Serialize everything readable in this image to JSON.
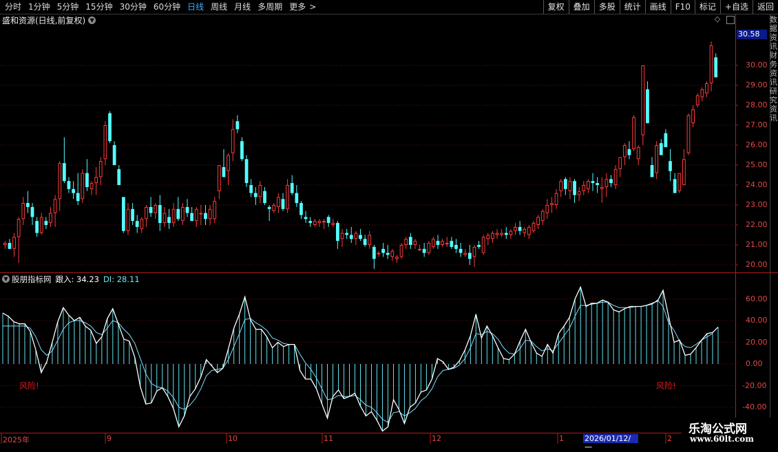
{
  "toolbar": {
    "tabs": [
      {
        "label": "分时",
        "active": false
      },
      {
        "label": "1分钟",
        "active": false
      },
      {
        "label": "5分钟",
        "active": false
      },
      {
        "label": "15分钟",
        "active": false
      },
      {
        "label": "30分钟",
        "active": false
      },
      {
        "label": "60分钟",
        "active": false
      },
      {
        "label": "日线",
        "active": true
      },
      {
        "label": "周线",
        "active": false
      },
      {
        "label": "月线",
        "active": false
      },
      {
        "label": "多周期",
        "active": false
      },
      {
        "label": "更多",
        "active": false
      }
    ],
    "right_buttons": [
      "复权",
      "叠加",
      "多股",
      "统计",
      "画线",
      "F10",
      "标记",
      "+自选",
      "返回"
    ]
  },
  "chart_title": "盛和资源(日线,前复权)",
  "indicator": {
    "name": "股朋指标网",
    "v1_label": "跟入: 34.23",
    "v2_label": "DI: 28.11"
  },
  "current_price": "30.58",
  "price_axis": [
    "30.00",
    "29.00",
    "28.00",
    "27.00",
    "26.00",
    "25.00",
    "24.00",
    "23.00",
    "22.00",
    "21.00",
    "20.00"
  ],
  "indicator_axis": [
    "60.00",
    "40.00",
    "20.00",
    "0.00",
    "-20.00",
    "-40.00"
  ],
  "dates": {
    "labels": [
      "2025年",
      "9",
      "10",
      "11",
      "12",
      "1",
      "2"
    ],
    "cursor": "2026/01/12/一"
  },
  "warnings": [
    "风险!",
    "风险!"
  ],
  "brand": {
    "name": "乐淘公式网",
    "url": "www.60lt.com"
  },
  "side_strip_text": "数据资讯财务资讯研究资讯",
  "colors": {
    "up": "#ff3c3c",
    "down": "#54ffff",
    "grid": "#7a1010",
    "axis": "#c01818",
    "line": "#ffffff",
    "di": "#7fdfff"
  },
  "chart_data": [
    {
      "type": "candlestick",
      "title": "盛和资源(日线,前复权)",
      "ylim": [
        19.6,
        31.2
      ],
      "candles": [
        [
          21.0,
          21.2,
          20.8,
          21.1
        ],
        [
          21.1,
          21.3,
          20.8,
          20.8
        ],
        [
          20.8,
          21.6,
          20.4,
          21.4
        ],
        [
          21.4,
          22.4,
          20.1,
          22.3
        ],
        [
          22.3,
          23.4,
          22.0,
          23.1
        ],
        [
          23.1,
          23.7,
          22.6,
          22.9
        ],
        [
          22.9,
          23.1,
          22.0,
          22.4
        ],
        [
          22.2,
          22.4,
          21.4,
          21.6
        ],
        [
          21.6,
          22.6,
          21.5,
          22.4
        ],
        [
          22.2,
          22.4,
          21.8,
          22.0
        ],
        [
          22.1,
          22.9,
          21.9,
          22.6
        ],
        [
          22.6,
          23.5,
          21.9,
          23.3
        ],
        [
          23.3,
          25.2,
          22.7,
          25.1
        ],
        [
          25.1,
          26.4,
          24.1,
          24.2
        ],
        [
          24.2,
          24.4,
          23.6,
          23.8
        ],
        [
          23.8,
          24.2,
          23.3,
          23.6
        ],
        [
          23.6,
          24.6,
          23.0,
          23.2
        ],
        [
          23.3,
          24.8,
          23.1,
          24.6
        ],
        [
          24.6,
          25.3,
          23.7,
          23.9
        ],
        [
          23.8,
          24.2,
          23.5,
          24.1
        ],
        [
          24.1,
          24.9,
          23.5,
          24.4
        ],
        [
          24.4,
          25.4,
          24.0,
          25.2
        ],
        [
          25.3,
          27.2,
          25.0,
          27.0
        ],
        [
          27.6,
          27.7,
          26.1,
          26.2
        ],
        [
          26.0,
          26.2,
          25.0,
          25.0
        ],
        [
          24.8,
          25.0,
          24.0,
          24.0
        ],
        [
          23.4,
          23.4,
          21.6,
          21.7
        ],
        [
          21.7,
          23.1,
          21.5,
          22.8
        ],
        [
          22.8,
          23.1,
          22.0,
          22.2
        ],
        [
          22.2,
          22.5,
          21.6,
          21.9
        ],
        [
          21.8,
          22.4,
          21.6,
          22.3
        ],
        [
          22.3,
          23.0,
          21.9,
          22.9
        ],
        [
          22.9,
          23.4,
          22.4,
          22.6
        ],
        [
          22.6,
          23.1,
          22.3,
          23.0
        ],
        [
          23.0,
          23.5,
          21.7,
          22.1
        ],
        [
          22.1,
          22.9,
          21.9,
          22.6
        ],
        [
          22.4,
          22.8,
          21.8,
          22.1
        ],
        [
          22.1,
          23.1,
          21.9,
          22.8
        ],
        [
          22.8,
          23.4,
          22.2,
          22.3
        ],
        [
          22.2,
          23.1,
          22.0,
          22.9
        ],
        [
          22.9,
          23.3,
          22.4,
          22.6
        ],
        [
          22.6,
          22.9,
          22.2,
          22.2
        ],
        [
          22.2,
          22.9,
          21.9,
          22.8
        ],
        [
          22.6,
          23.0,
          22.0,
          22.6
        ],
        [
          22.6,
          23.0,
          22.0,
          22.3
        ],
        [
          22.3,
          23.0,
          22.0,
          22.8
        ],
        [
          22.3,
          23.4,
          22.1,
          23.2
        ],
        [
          23.7,
          25.0,
          23.3,
          25.0
        ],
        [
          24.9,
          25.8,
          24.4,
          24.4
        ],
        [
          24.7,
          25.6,
          24.0,
          25.5
        ],
        [
          25.6,
          27.3,
          25.2,
          26.8
        ],
        [
          27.2,
          27.5,
          26.6,
          26.8
        ],
        [
          26.2,
          26.4,
          25.2,
          25.3
        ],
        [
          25.3,
          25.5,
          23.9,
          24.1
        ],
        [
          24.0,
          24.3,
          23.4,
          23.6
        ],
        [
          23.6,
          23.9,
          23.0,
          23.4
        ],
        [
          23.4,
          24.2,
          23.1,
          24.0
        ],
        [
          23.7,
          23.9,
          23.0,
          23.1
        ],
        [
          22.9,
          23.0,
          22.2,
          22.8
        ],
        [
          22.7,
          23.1,
          22.6,
          23.0
        ],
        [
          22.9,
          23.6,
          22.6,
          23.4
        ],
        [
          23.3,
          23.6,
          22.7,
          22.8
        ],
        [
          22.8,
          24.3,
          22.6,
          24.0
        ],
        [
          24.1,
          24.5,
          23.5,
          23.6
        ],
        [
          23.6,
          24.0,
          22.9,
          23.1
        ],
        [
          23.1,
          23.2,
          22.3,
          22.5
        ],
        [
          22.4,
          22.7,
          22.1,
          22.3
        ],
        [
          22.2,
          22.4,
          21.9,
          22.1
        ],
        [
          22.0,
          22.3,
          21.9,
          22.2
        ],
        [
          22.1,
          22.3,
          21.9,
          22.2
        ],
        [
          22.2,
          22.3,
          21.8,
          22.2
        ],
        [
          22.4,
          22.5,
          21.9,
          22.1
        ],
        [
          22.0,
          22.3,
          21.9,
          22.1
        ],
        [
          22.1,
          22.2,
          20.8,
          21.2
        ],
        [
          21.3,
          21.8,
          20.9,
          21.6
        ],
        [
          21.6,
          21.8,
          21.3,
          21.5
        ],
        [
          21.5,
          21.9,
          21.1,
          21.3
        ],
        [
          21.3,
          21.7,
          21.0,
          21.6
        ],
        [
          21.5,
          21.8,
          21.2,
          21.3
        ],
        [
          21.3,
          21.5,
          20.9,
          21.0
        ],
        [
          21.0,
          21.7,
          20.8,
          21.5
        ],
        [
          20.9,
          21.0,
          19.8,
          20.3
        ],
        [
          20.6,
          20.7,
          20.4,
          20.6
        ],
        [
          20.8,
          21.1,
          20.4,
          20.6
        ],
        [
          20.6,
          21.0,
          20.3,
          20.5
        ],
        [
          20.4,
          20.8,
          20.2,
          20.7
        ],
        [
          20.3,
          20.5,
          20.1,
          20.4
        ],
        [
          20.4,
          21.1,
          20.3,
          21.0
        ],
        [
          21.0,
          21.4,
          20.8,
          21.3
        ],
        [
          21.4,
          21.6,
          20.8,
          21.0
        ],
        [
          21.0,
          21.3,
          20.8,
          21.2
        ],
        [
          20.8,
          21.0,
          20.7,
          20.8
        ],
        [
          20.8,
          21.1,
          20.4,
          20.6
        ],
        [
          20.6,
          21.2,
          20.5,
          21.1
        ],
        [
          20.9,
          21.4,
          20.8,
          21.3
        ],
        [
          21.2,
          21.5,
          20.8,
          21.0
        ],
        [
          21.0,
          21.3,
          20.9,
          21.2
        ],
        [
          21.1,
          21.4,
          20.9,
          21.1
        ],
        [
          21.2,
          21.4,
          20.8,
          20.9
        ],
        [
          21.0,
          21.3,
          20.6,
          20.8
        ],
        [
          20.8,
          21.1,
          20.4,
          20.6
        ],
        [
          20.5,
          20.8,
          20.4,
          20.6
        ],
        [
          20.6,
          21.0,
          20.0,
          20.3
        ],
        [
          20.4,
          21.0,
          19.9,
          20.9
        ],
        [
          21.0,
          21.2,
          20.8,
          20.9
        ],
        [
          20.6,
          21.5,
          20.5,
          21.4
        ],
        [
          21.3,
          21.6,
          21.0,
          21.5
        ],
        [
          21.3,
          21.7,
          21.1,
          21.6
        ],
        [
          21.5,
          21.8,
          21.3,
          21.6
        ],
        [
          21.5,
          21.8,
          21.4,
          21.6
        ],
        [
          21.6,
          21.9,
          21.3,
          21.5
        ],
        [
          21.5,
          21.8,
          21.3,
          21.7
        ],
        [
          21.7,
          22.1,
          21.5,
          21.9
        ],
        [
          21.9,
          22.2,
          21.5,
          21.7
        ],
        [
          21.6,
          21.9,
          21.4,
          21.8
        ],
        [
          21.5,
          22.0,
          21.3,
          21.9
        ],
        [
          21.7,
          22.2,
          21.6,
          22.1
        ],
        [
          22.0,
          22.5,
          21.8,
          22.4
        ],
        [
          22.2,
          22.8,
          22.0,
          22.7
        ],
        [
          22.6,
          23.3,
          22.3,
          23.0
        ],
        [
          23.0,
          23.4,
          22.6,
          23.1
        ],
        [
          23.0,
          23.8,
          22.8,
          23.6
        ],
        [
          23.7,
          24.3,
          23.4,
          24.2
        ],
        [
          24.3,
          24.4,
          23.5,
          23.8
        ],
        [
          23.7,
          24.4,
          23.3,
          24.2
        ],
        [
          24.2,
          24.3,
          23.1,
          23.5
        ],
        [
          23.5,
          23.9,
          23.2,
          23.7
        ],
        [
          23.7,
          24.2,
          23.5,
          24.0
        ],
        [
          23.8,
          24.3,
          23.6,
          24.2
        ],
        [
          24.2,
          24.6,
          23.7,
          24.1
        ],
        [
          24.1,
          24.4,
          23.6,
          24.0
        ],
        [
          23.8,
          24.4,
          23.1,
          23.9
        ],
        [
          23.9,
          24.6,
          23.4,
          24.3
        ],
        [
          24.3,
          24.5,
          23.9,
          24.1
        ],
        [
          24.0,
          25.0,
          23.8,
          24.8
        ],
        [
          24.8,
          25.4,
          24.4,
          25.4
        ],
        [
          25.4,
          26.1,
          25.0,
          26.0
        ],
        [
          25.8,
          26.2,
          25.3,
          25.5
        ],
        [
          25.8,
          27.5,
          25.7,
          27.4
        ],
        [
          25.3,
          26.0,
          25.0,
          25.9
        ],
        [
          26.5,
          30.0,
          26.0,
          30.0
        ],
        [
          28.8,
          29.2,
          27.1,
          27.1
        ],
        [
          25.0,
          25.4,
          24.4,
          24.4
        ],
        [
          24.6,
          26.2,
          24.3,
          26.0
        ],
        [
          26.1,
          26.3,
          25.5,
          25.5
        ],
        [
          26.6,
          26.8,
          25.9,
          25.9
        ],
        [
          25.2,
          25.8,
          24.2,
          24.7
        ],
        [
          24.3,
          24.6,
          23.6,
          23.6
        ],
        [
          23.7,
          24.6,
          23.6,
          24.6
        ],
        [
          24.0,
          25.8,
          24.0,
          25.3
        ],
        [
          25.6,
          27.6,
          25.5,
          27.5
        ],
        [
          27.1,
          28.0,
          26.9,
          27.8
        ],
        [
          28.0,
          28.6,
          27.9,
          28.5
        ],
        [
          28.4,
          28.9,
          28.2,
          28.8
        ],
        [
          28.6,
          29.2,
          28.4,
          29.1
        ],
        [
          29.1,
          31.2,
          28.7,
          31.0
        ],
        [
          30.4,
          30.6,
          29.4,
          29.4
        ]
      ]
    },
    {
      "type": "line",
      "title": "股朋指标网",
      "ylim": [
        -50,
        73
      ],
      "series": [
        {
          "name": "跟入",
          "values": [
            47,
            44,
            39,
            37,
            37,
            30,
            13,
            -8,
            2,
            20,
            39,
            52,
            45,
            40,
            43,
            35,
            31,
            19,
            25,
            42,
            51,
            37,
            23,
            21,
            6,
            -21,
            -37,
            -36,
            -25,
            -22,
            -30,
            -41,
            -58,
            -48,
            -30,
            -23,
            -12,
            4,
            -2,
            -8,
            -4,
            14,
            33,
            46,
            62,
            41,
            32,
            32,
            25,
            15,
            20,
            16,
            18,
            18,
            -6,
            -14,
            -14,
            -23,
            -37,
            -50,
            -30,
            -24,
            -32,
            -30,
            -27,
            -39,
            -48,
            -44,
            -52,
            -62,
            -58,
            -33,
            -42,
            -55,
            -40,
            -36,
            -26,
            -24,
            -14,
            5,
            2,
            -5,
            -3,
            3,
            13,
            26,
            46,
            24,
            35,
            26,
            15,
            5,
            4,
            9,
            21,
            32,
            20,
            10,
            7,
            18,
            10,
            28,
            35,
            43,
            60,
            71,
            53,
            56,
            56,
            59,
            57,
            50,
            48,
            51,
            53,
            53,
            53,
            54,
            56,
            58,
            68,
            44,
            20,
            22,
            8,
            9,
            15,
            22,
            28,
            29,
            34
          ]
        },
        {
          "name": "DI",
          "values": [
            35,
            35,
            35,
            35,
            35,
            33,
            25,
            13,
            8,
            12,
            22,
            32,
            38,
            40,
            40,
            38,
            35,
            29,
            27,
            33,
            40,
            38,
            32,
            27,
            19,
            5,
            -9,
            -18,
            -21,
            -22,
            -25,
            -31,
            -40,
            -42,
            -38,
            -32,
            -23,
            -11,
            -6,
            -5,
            -4,
            4,
            16,
            28,
            41,
            42,
            38,
            35,
            31,
            24,
            22,
            19,
            18,
            18,
            9,
            1,
            -5,
            -13,
            -23,
            -33,
            -32,
            -29,
            -30,
            -30,
            -29,
            -33,
            -38,
            -40,
            -45,
            -51,
            -54,
            -45,
            -44,
            -48,
            -45,
            -41,
            -34,
            -30,
            -23,
            -12,
            -6,
            -5,
            -4,
            -1,
            5,
            15,
            28,
            27,
            30,
            28,
            23,
            15,
            10,
            9,
            14,
            22,
            21,
            16,
            12,
            14,
            12,
            19,
            26,
            33,
            44,
            54,
            54,
            55,
            56,
            57,
            57,
            54,
            52,
            52,
            52,
            53,
            53,
            54,
            55,
            59,
            53,
            38,
            31,
            21,
            16,
            15,
            18,
            22,
            25,
            28
          ]
        }
      ],
      "bars": "positive values of 跟入 drawn as vertical cyan sticks",
      "annotations": [
        "风险!",
        "风险!"
      ]
    }
  ]
}
